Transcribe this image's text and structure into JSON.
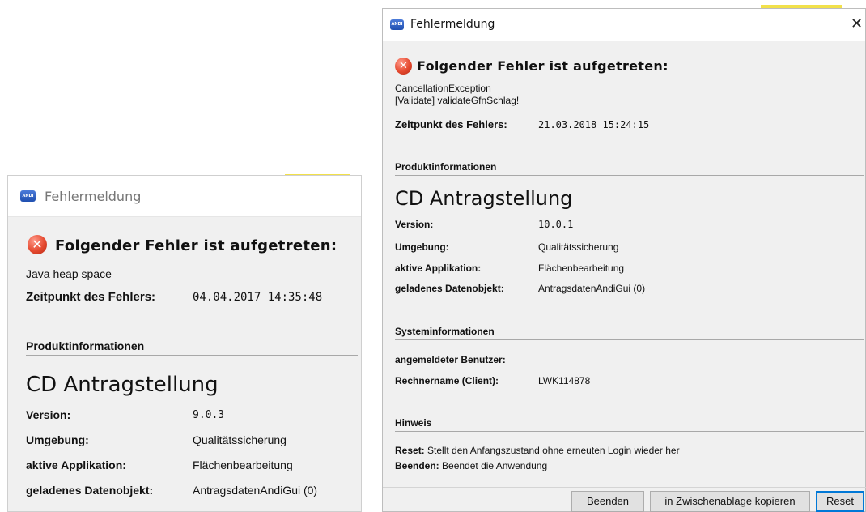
{
  "left": {
    "title": "Fehlermeldung",
    "icon_text": "ANDI",
    "heading": "Folgender Fehler ist aufgetreten:",
    "message": "Java heap space",
    "time_label": "Zeitpunkt des Fehlers:",
    "time_value": "04.04.2017 14:35:48",
    "section_product": "Produktinformationen",
    "product_name": "CD Antragstellung",
    "fields": [
      {
        "label": "Version:",
        "value": "9.0.3"
      },
      {
        "label": "Umgebung:",
        "value": "Qualitätssicherung"
      },
      {
        "label": "aktive Applikation:",
        "value": "Flächenbearbeitung"
      },
      {
        "label": "geladenes Datenobjekt:",
        "value": "AntragsdatenAndiGui (0)"
      }
    ]
  },
  "right": {
    "title": "Fehlermeldung",
    "icon_text": "ANDI",
    "close_glyph": "✕",
    "heading": "Folgender Fehler ist aufgetreten:",
    "message_lines": [
      "CancellationException",
      "[Validate] validateGfnSchlag!"
    ],
    "time_label": "Zeitpunkt des Fehlers:",
    "time_value": "21.03.2018 15:24:15",
    "section_product": "Produktinformationen",
    "product_name": "CD Antragstellung",
    "fields": [
      {
        "label": "Version:",
        "value": "10.0.1"
      },
      {
        "label": "Umgebung:",
        "value": "Qualitätssicherung"
      },
      {
        "label": "aktive Applikation:",
        "value": "Flächenbearbeitung"
      },
      {
        "label": "geladenes Datenobjekt:",
        "value": "AntragsdatenAndiGui (0)"
      }
    ],
    "section_system": "Systeminformationen",
    "system_fields": [
      {
        "label": "angemeldeter Benutzer:",
        "value": ""
      },
      {
        "label": "Rechnername (Client):",
        "value": "LWK114878"
      }
    ],
    "section_hint": "Hinweis",
    "hints": [
      {
        "label": "Reset:",
        "text": "Stellt den Anfangszustand ohne erneuten Login wieder her"
      },
      {
        "label": "Beenden:",
        "text": "Beendet die Anwendung"
      }
    ],
    "buttons": {
      "quit": "Beenden",
      "copy": "in Zwischenablage kopieren",
      "reset": "Reset"
    }
  },
  "colors": {
    "accent": "#0078d7",
    "error_icon": "#e5492f",
    "dialog_bg": "#f0f0f0"
  }
}
